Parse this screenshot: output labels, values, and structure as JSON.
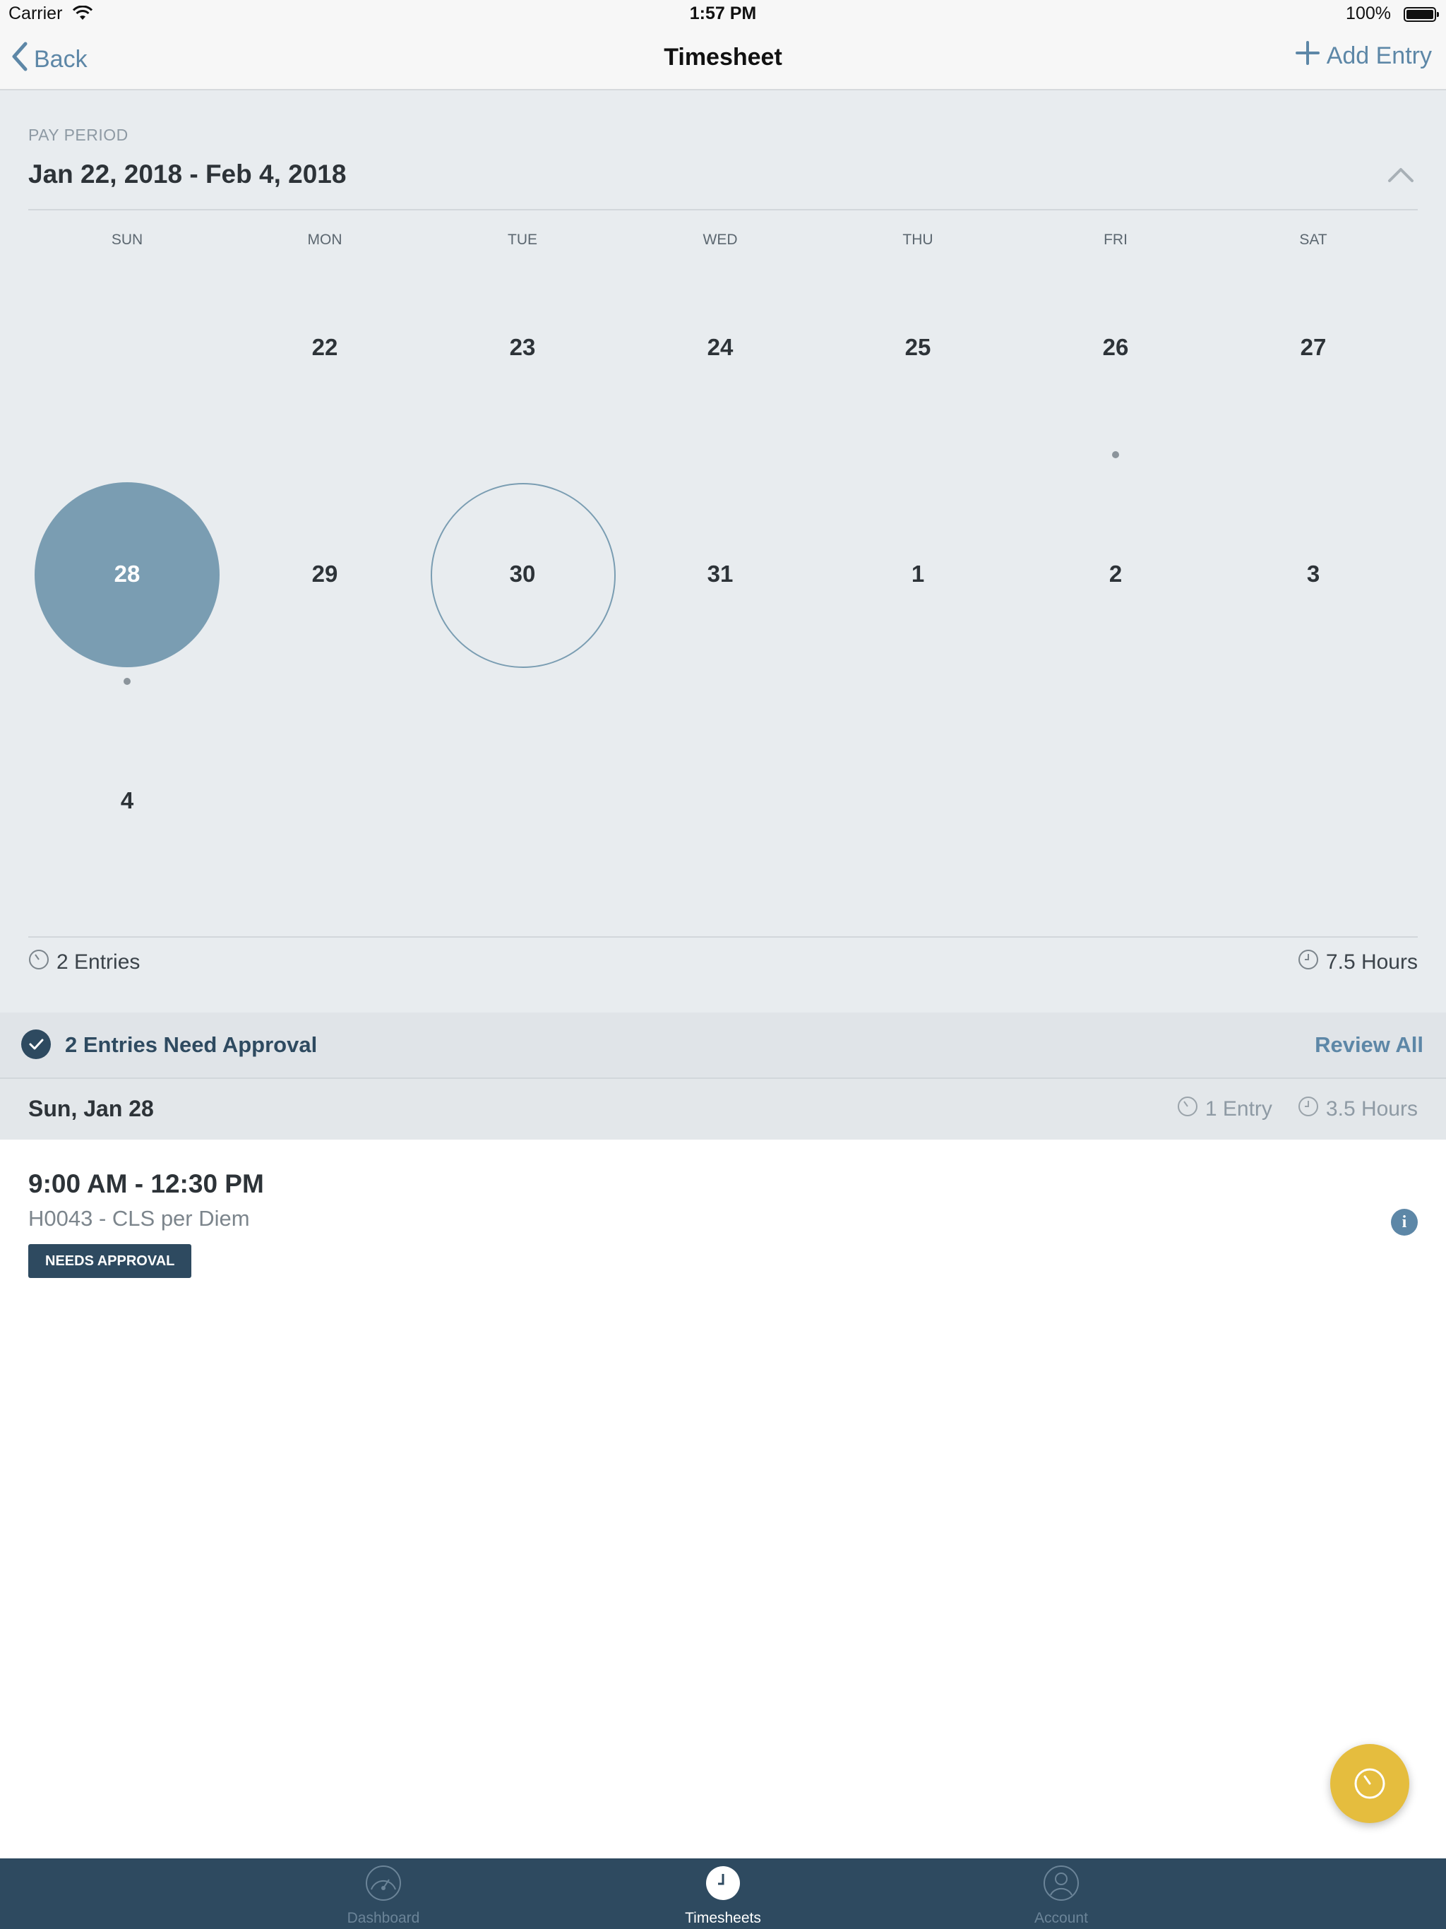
{
  "status_bar": {
    "carrier": "Carrier",
    "time": "1:57 PM",
    "battery": "100%"
  },
  "nav": {
    "back_label": "Back",
    "title": "Timesheet",
    "add_label": "Add Entry"
  },
  "pay_period": {
    "label": "PAY PERIOD",
    "range": "Jan 22, 2018 - Feb 4, 2018"
  },
  "calendar": {
    "weekdays": [
      "SUN",
      "MON",
      "TUE",
      "WED",
      "THU",
      "FRI",
      "SAT"
    ],
    "weeks": [
      [
        "",
        "22",
        "23",
        "24",
        "25",
        "26",
        "27"
      ],
      [
        "28",
        "29",
        "30",
        "31",
        "1",
        "2",
        "3"
      ],
      [
        "4",
        "",
        "",
        "",
        "",
        "",
        ""
      ]
    ],
    "selected_day": "28",
    "today": "30",
    "days_with_entries": [
      "26",
      "28"
    ],
    "colors": {
      "selected": "#7a9db2",
      "accent": "#5d87a7"
    }
  },
  "summary": {
    "entries": "2 Entries",
    "hours": "7.5 Hours"
  },
  "approval": {
    "text": "2 Entries Need Approval",
    "action": "Review All"
  },
  "day": {
    "date": "Sun, Jan 28",
    "entries": "1 Entry",
    "hours": "3.5 Hours"
  },
  "entry": {
    "time": "9:00 AM - 12:30 PM",
    "code": "H0043 - CLS per Diem",
    "status": "NEEDS APPROVAL",
    "info_icon": "i"
  },
  "fab": {
    "icon": "timer-icon",
    "color": "#e5bd3e"
  },
  "tabs": [
    {
      "label": "Dashboard",
      "icon": "speedometer-icon"
    },
    {
      "label": "Timesheets",
      "icon": "clock-icon"
    },
    {
      "label": "Account",
      "icon": "user-icon"
    }
  ]
}
